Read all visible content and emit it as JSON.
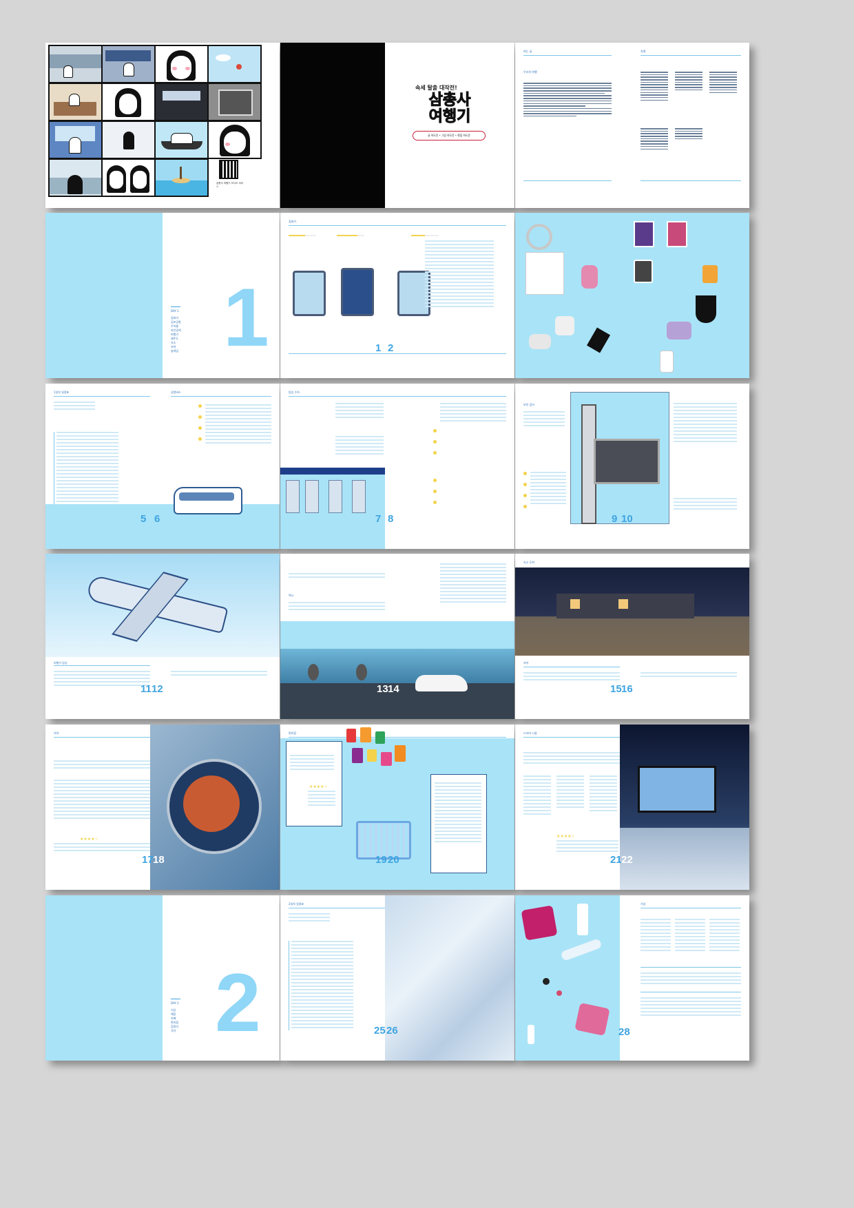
{
  "cover": {
    "tagline": "속세 탈출 대작전!",
    "title_line1": "삼총사",
    "title_line2": "여행기",
    "credits": "글 하도윤 • 그림 하도윤 • 편집 하도윤"
  },
  "comic": {
    "qr_caption": "삼총사 여행기 오디오 서비스"
  },
  "contents": {
    "foreword_title": "여는 글",
    "toc_title": "차례",
    "preface_heading": "우리의 여행"
  },
  "chapter1": {
    "day": "DAY 1",
    "items": [
      "짐싸기",
      "김포공항",
      "수하물",
      "보안검색",
      "비행기",
      "제주도",
      "숙소",
      "저녁",
      "술게임"
    ],
    "number": "1"
  },
  "chapter2": {
    "day": "DAY 2",
    "items": [
      "기상",
      "해장",
      "카페",
      "편의점",
      "짐정리",
      "귀가"
    ],
    "number": "2"
  },
  "section_heads": {
    "packing": "짐싸기",
    "schedule": "1일차 일정표",
    "bus": "공항버스",
    "checkin": "탑승 수속",
    "security": "보안 검사",
    "flight": "비행기 탑승",
    "taxi": "택시",
    "house": "숙소 도착",
    "dinner": "저녁",
    "store": "편의점",
    "drama": "드라마 시청",
    "day2": "2일차 일정표",
    "wake": "기상"
  },
  "page_numbers": {
    "p1": "1",
    "p2": "2",
    "p5": "5",
    "p6": "6",
    "p7": "7",
    "p8": "8",
    "p9": "9",
    "p10": "10",
    "p11": "11",
    "p12": "12",
    "p13": "13",
    "p14": "14",
    "p15": "15",
    "p16": "16",
    "p17": "17",
    "p18": "18",
    "p19": "19",
    "p20": "20",
    "p21": "21",
    "p22": "22",
    "p25": "25",
    "p26": "26",
    "p28": "28"
  },
  "colors": {
    "accent": "#3ea4e0",
    "sky": "#a9e3f7",
    "cover_red": "#c8203c",
    "text": "#2e72b8"
  },
  "icons": [
    "qr-code-icon",
    "suitcase-icon",
    "airplane-icon",
    "taxi-icon",
    "bus-icon",
    "star-icon"
  ]
}
